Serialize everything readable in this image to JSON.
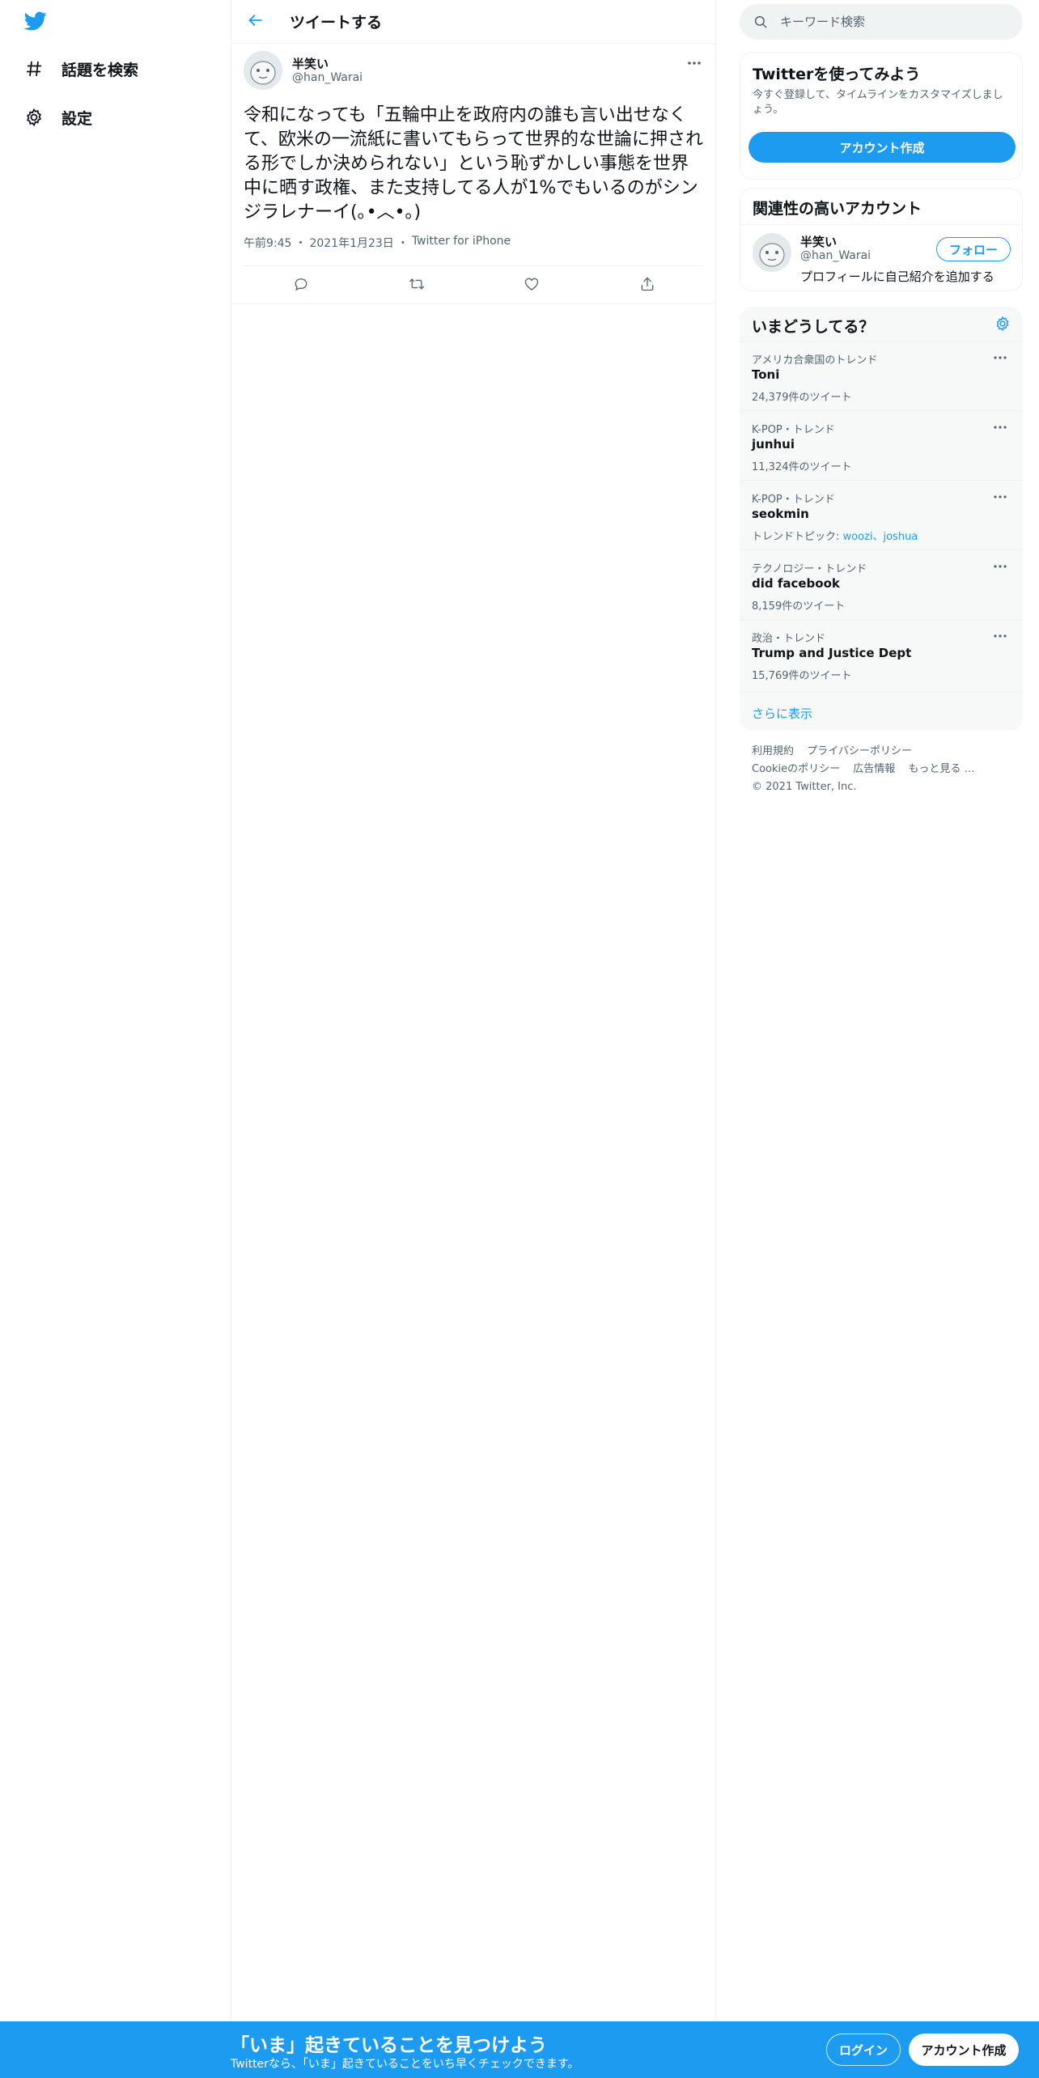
{
  "colors": {
    "accent": "#1d9bf0",
    "text": "#0f1419",
    "secondary": "#536471",
    "border": "#eff3f4"
  },
  "nav": {
    "logo_icon": "twitter-bird-icon",
    "items": [
      {
        "label": "話題を検索",
        "icon": "hashtag-icon"
      },
      {
        "label": "設定",
        "icon": "gear-icon"
      }
    ]
  },
  "header": {
    "title": "ツイートする",
    "back_icon": "arrow-left-icon"
  },
  "tweet": {
    "author_name": "半笑い",
    "author_handle": "@han_Warai",
    "text": "令和になっても「五輪中止を政府内の誰も言い出せなくて、欧米の一流紙に書いてもらって世界的な世論に押される形でしか決められない」という恥ずかしい事態を世界中に晒す政権、また支持してる人が1%でもいるのがシンジラレナーイ(｡•︿•｡)",
    "time": "午前9:45",
    "date": "2021年1月23日",
    "source": "Twitter for iPhone",
    "meta_sep": "・",
    "actions": [
      "reply-icon",
      "retweet-icon",
      "like-icon",
      "share-icon"
    ]
  },
  "search": {
    "placeholder": "キーワード検索"
  },
  "signup_card": {
    "title": "Twitterを使ってみよう",
    "description": "今すぐ登録して、タイムラインをカスタマイズしましょう。",
    "button": "アカウント作成"
  },
  "relevant": {
    "title": "関連性の高いアカウント",
    "name": "半笑い",
    "handle": "@han_Warai",
    "bio": "プロフィールに自己紹介を追加する",
    "follow": "フォロー"
  },
  "trends": {
    "title": "いまどうしてる？",
    "items": [
      {
        "context": "アメリカ合衆国のトレンド",
        "name": "Toni",
        "count": "24,379件のツイート"
      },
      {
        "context": "K-POP・トレンド",
        "name": "junhui",
        "count": "11,324件のツイート"
      },
      {
        "context": "K-POP・トレンド",
        "name": "seokmin",
        "topics_label": "トレンドトピック: ",
        "topics": "woozi、joshua"
      },
      {
        "context": "テクノロジー・トレンド",
        "name": "did facebook",
        "count": "8,159件のツイート"
      },
      {
        "context": "政治・トレンド",
        "name": "Trump and Justice Dept",
        "count": "15,769件のツイート"
      }
    ],
    "show_more": "さらに表示"
  },
  "footer": {
    "links": [
      "利用規約",
      "プライバシーポリシー",
      "Cookieのポリシー",
      "広告情報",
      "もっと見る …",
      "© 2021 Twitter, Inc."
    ]
  },
  "bottom_bar": {
    "title": "「いま」起きていることを見つけよう",
    "subtitle": "Twitterなら、「いま」起きていることをいち早くチェックできます。",
    "login": "ログイン",
    "signup": "アカウント作成"
  }
}
